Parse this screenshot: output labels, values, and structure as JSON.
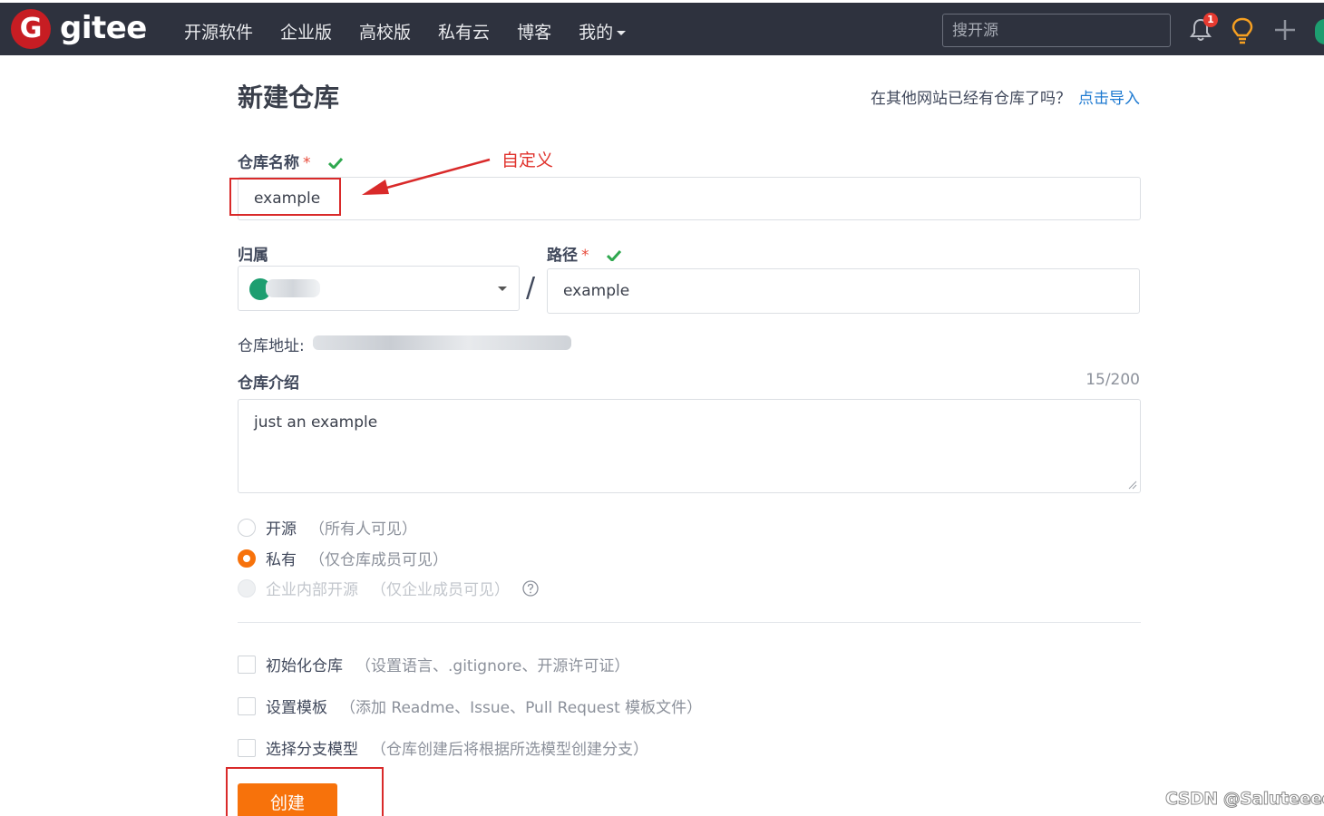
{
  "header": {
    "logo_letter": "G",
    "brand": "gitee",
    "nav": [
      "开源软件",
      "企业版",
      "高校版",
      "私有云",
      "博客",
      "我的"
    ],
    "search_placeholder": "搜开源",
    "notification_count": "1"
  },
  "page": {
    "title": "新建仓库",
    "import_hint": "在其他网站已经有仓库了吗？",
    "import_link": "点击导入"
  },
  "form": {
    "repo_name_label": "仓库名称",
    "required_mark": "*",
    "repo_name_value": "example",
    "owner_label": "归属",
    "path_label": "路径",
    "path_value": "example",
    "address_label": "仓库地址:",
    "intro_label": "仓库介绍",
    "intro_counter": "15/200",
    "intro_value": "just an example",
    "visibility": [
      {
        "label": "开源",
        "note": "（所有人可见）",
        "selected": false,
        "disabled": false
      },
      {
        "label": "私有",
        "note": "（仅仓库成员可见）",
        "selected": true,
        "disabled": false
      },
      {
        "label": "企业内部开源",
        "note": "（仅企业成员可见）",
        "selected": false,
        "disabled": true
      }
    ],
    "options": [
      {
        "label": "初始化仓库",
        "note": "（设置语言、.gitignore、开源许可证）"
      },
      {
        "label": "设置模板",
        "note": "（添加 Readme、Issue、Pull Request 模板文件）"
      },
      {
        "label": "选择分支模型",
        "note": "（仓库创建后将根据所选模型创建分支）"
      }
    ],
    "create_button": "创建"
  },
  "annotation": {
    "text": "自定义"
  },
  "watermark": "CSDN @Saluteeee",
  "colors": {
    "topbar": "#2e323e",
    "accent_orange": "#f7720b",
    "brand_red": "#c71d23",
    "link_blue": "#1e7ad1",
    "annotation_red": "#d92a2a"
  }
}
